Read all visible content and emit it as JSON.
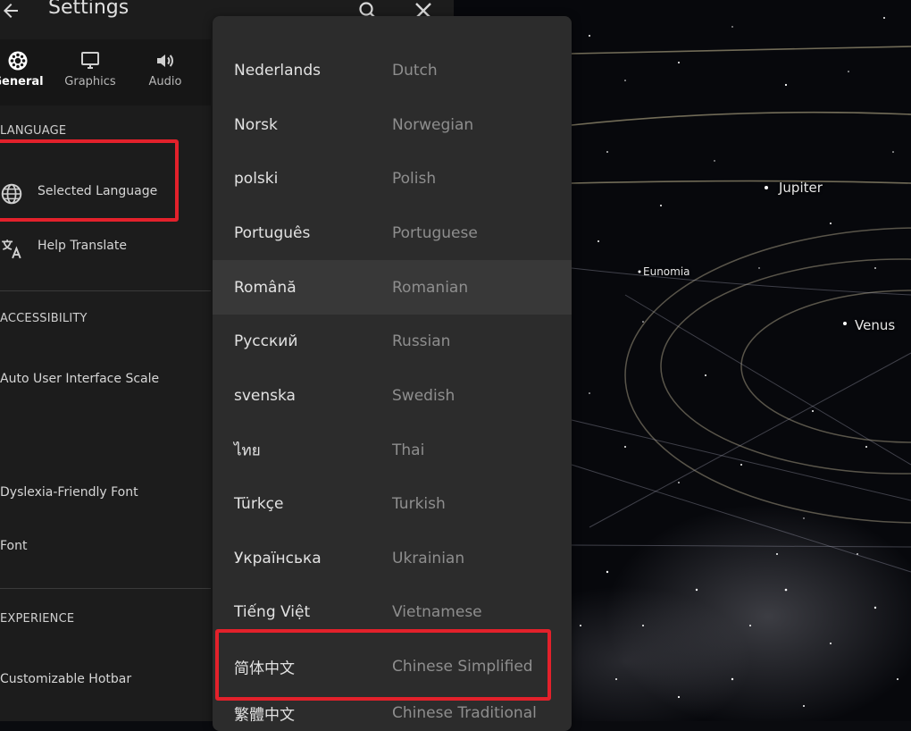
{
  "header": {
    "title": "Settings"
  },
  "tabs": [
    {
      "label": "General",
      "icon": "gear-icon",
      "active": true
    },
    {
      "label": "Graphics",
      "icon": "monitor-icon",
      "active": false
    },
    {
      "label": "Audio",
      "icon": "speaker-icon",
      "active": false
    }
  ],
  "sections": {
    "language": "LANGUAGE",
    "accessibility": "ACCESSIBILITY",
    "experience": "EXPERIENCE"
  },
  "settings": {
    "selected_language": "Selected Language",
    "help_translate": "Help Translate",
    "auto_ui_scale": "Auto User Interface Scale",
    "dyslexia_font": "Dyslexia-Friendly Font",
    "font": "Font",
    "customizable_hotbar": "Customizable Hotbar"
  },
  "languages": [
    {
      "native": "Nederlands",
      "english": "Dutch"
    },
    {
      "native": "Norsk",
      "english": "Norwegian"
    },
    {
      "native": "polski",
      "english": "Polish"
    },
    {
      "native": "Português",
      "english": "Portuguese"
    },
    {
      "native": "Română",
      "english": "Romanian",
      "hovered": true
    },
    {
      "native": "Русский",
      "english": "Russian"
    },
    {
      "native": "svenska",
      "english": "Swedish"
    },
    {
      "native": "ไทย",
      "english": "Thai"
    },
    {
      "native": "Türkçe",
      "english": "Turkish"
    },
    {
      "native": "Українська",
      "english": "Ukrainian"
    },
    {
      "native": "Tiếng Việt",
      "english": "Vietnamese"
    },
    {
      "native": "简体中文",
      "english": "Chinese Simplified",
      "highlighted": true
    },
    {
      "native": "繁體中文",
      "english": "Chinese Traditional"
    }
  ],
  "map_labels": {
    "jupiter": "Jupiter",
    "eunomia": "Eunomia",
    "venus": "Venus"
  },
  "colors": {
    "highlight": "#e3212b",
    "panel": "#1c1c1c",
    "dropdown": "#2c2c2c"
  }
}
